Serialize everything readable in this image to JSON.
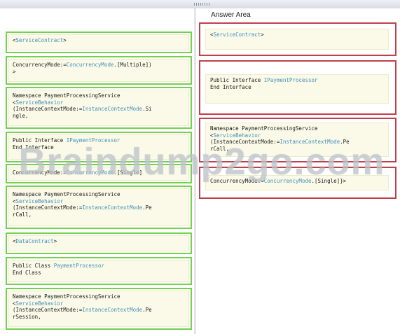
{
  "answer_area_title": "Answer Area",
  "watermark": "Braindump2go.com",
  "left_items": [
    {
      "lines": [
        [
          {
            "t": "<",
            "c": "kw"
          },
          {
            "t": "ServiceContract",
            "c": "tp"
          },
          {
            "t": ">",
            "c": "kw"
          }
        ]
      ]
    },
    {
      "lines": [
        [
          {
            "t": "ConcurrencyMode:=",
            "c": "kw"
          },
          {
            "t": "ConcurrencyMode",
            "c": "tp"
          },
          {
            "t": ".[Multiple])",
            "c": "kw"
          }
        ],
        [
          {
            "t": ">",
            "c": "kw"
          }
        ]
      ]
    },
    {
      "lines": [
        [
          {
            "t": "Namespace PaymentProcessingService",
            "c": "kw"
          }
        ],
        [
          {
            "t": "<",
            "c": "kw"
          },
          {
            "t": "ServiceBehavior",
            "c": "tp"
          }
        ],
        [
          {
            "t": "(InstanceContextMode:=",
            "c": "kw"
          },
          {
            "t": "InstanceContextMode",
            "c": "tp"
          },
          {
            "t": ".Si",
            "c": "kw"
          }
        ],
        [
          {
            "t": "ngle,",
            "c": "kw"
          }
        ]
      ]
    },
    {
      "lines": [
        [
          {
            "t": "Public Interface ",
            "c": "kw"
          },
          {
            "t": "IPaymentProcessor",
            "c": "tp"
          }
        ],
        [
          {
            "t": "End Interface",
            "c": "kw"
          }
        ]
      ]
    },
    {
      "lines": [
        [
          {
            "t": "ConcurrencyMode:=",
            "c": "kw"
          },
          {
            "t": "ConcurrencyMode",
            "c": "tp"
          },
          {
            "t": ".[Single]",
            "c": "kw"
          }
        ]
      ]
    },
    {
      "lines": [
        [
          {
            "t": "Namespace PaymentProcessingService",
            "c": "kw"
          }
        ],
        [
          {
            "t": "<",
            "c": "kw"
          },
          {
            "t": "ServiceBehavior",
            "c": "tp"
          }
        ],
        [
          {
            "t": "(InstanceContextMode:=",
            "c": "kw"
          },
          {
            "t": "InstanceContextMode",
            "c": "tp"
          },
          {
            "t": ".Pe",
            "c": "kw"
          }
        ],
        [
          {
            "t": "rCall,",
            "c": "kw"
          }
        ]
      ]
    },
    {
      "lines": [
        [
          {
            "t": "<",
            "c": "kw"
          },
          {
            "t": "DataContract",
            "c": "tp"
          },
          {
            "t": ">",
            "c": "kw"
          }
        ]
      ]
    },
    {
      "lines": [
        [
          {
            "t": "Public Class ",
            "c": "kw"
          },
          {
            "t": "PaymentProcessor",
            "c": "tp"
          }
        ],
        [
          {
            "t": "End Class",
            "c": "kw"
          }
        ]
      ]
    },
    {
      "lines": [
        [
          {
            "t": "Namespace PaymentProcessingService",
            "c": "kw"
          }
        ],
        [
          {
            "t": "<",
            "c": "kw"
          },
          {
            "t": "ServiceBehavior",
            "c": "tp"
          }
        ],
        [
          {
            "t": "(InstanceContextMode:=",
            "c": "kw"
          },
          {
            "t": "InstanceContextMode",
            "c": "tp"
          },
          {
            "t": ".Pe",
            "c": "kw"
          }
        ],
        [
          {
            "t": "rSession,",
            "c": "kw"
          }
        ]
      ]
    }
  ],
  "answer_slots": [
    {
      "lines": [
        [
          {
            "t": "<",
            "c": "kw"
          },
          {
            "t": "ServiceContract",
            "c": "tp"
          },
          {
            "t": ">",
            "c": "kw"
          }
        ]
      ]
    },
    {
      "lines": [
        [
          {
            "t": "Public Interface ",
            "c": "kw"
          },
          {
            "t": "IPaymentProcessor",
            "c": "tp"
          }
        ],
        [
          {
            "t": "End Interface",
            "c": "kw"
          }
        ]
      ]
    },
    {
      "lines": [
        [
          {
            "t": "Namespace PaymentProcessingService",
            "c": "kw"
          }
        ],
        [
          {
            "t": "<",
            "c": "kw"
          },
          {
            "t": "ServiceBehavior",
            "c": "tp"
          }
        ],
        [
          {
            "t": "(InstanceContextMode:=",
            "c": "kw"
          },
          {
            "t": "InstanceContextMode",
            "c": "tp"
          },
          {
            "t": ".Pe",
            "c": "kw"
          }
        ],
        [
          {
            "t": "rCall,",
            "c": "kw"
          }
        ]
      ]
    },
    {
      "lines": [
        [
          {
            "t": "ConcurrencyMode:=",
            "c": "kw"
          },
          {
            "t": "ConcurrencyMode",
            "c": "tp"
          },
          {
            "t": ".[Single]}>",
            "c": "kw"
          }
        ]
      ]
    }
  ]
}
